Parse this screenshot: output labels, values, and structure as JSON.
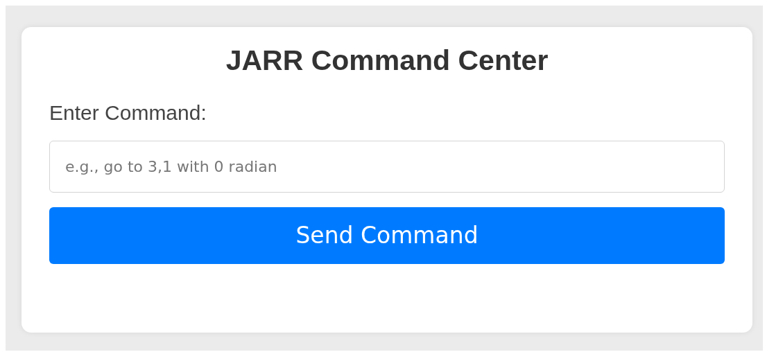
{
  "title": "JARR Command Center",
  "command_label": "Enter Command:",
  "command_field": {
    "placeholder": "e.g., go to 3,1 with 0 radian"
  },
  "send_button": "Send Command"
}
